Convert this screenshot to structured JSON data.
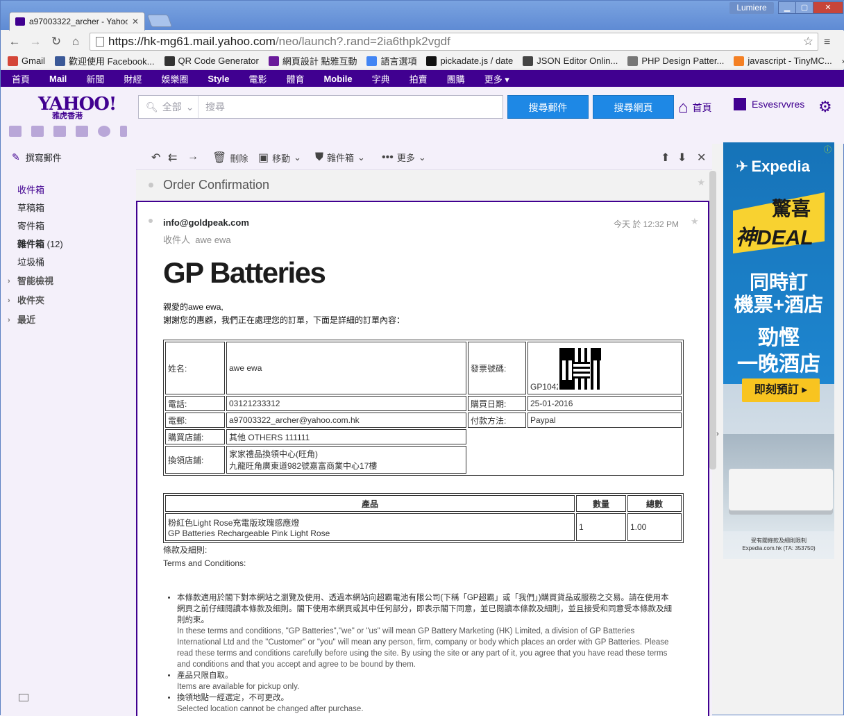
{
  "browser": {
    "tab_title": "a97003322_archer - Yahoo",
    "user_chip": "Lumiere",
    "url_host": "https://hk-mg61.mail.yahoo.com",
    "url_path": "/neo/launch?.rand=2ia6thpk2vgdf"
  },
  "bookmarks": [
    {
      "label": "Gmail",
      "icon": "gmail-icon",
      "color": "#d44638"
    },
    {
      "label": "歡迎使用 Facebook...",
      "icon": "facebook-icon",
      "color": "#3b5998"
    },
    {
      "label": "QR Code Generator",
      "icon": "qr-icon",
      "color": "#333333"
    },
    {
      "label": "網頁設計 點雅互動",
      "icon": "d-icon",
      "color": "#6a1b9a"
    },
    {
      "label": "語言選項",
      "icon": "translate-icon",
      "color": "#4285f4"
    },
    {
      "label": "pickadate.js / date",
      "icon": "p-icon",
      "color": "#111111"
    },
    {
      "label": "JSON Editor Onlin...",
      "icon": "json-icon",
      "color": "#444444"
    },
    {
      "label": "PHP Design Patter...",
      "icon": "php-icon",
      "color": "#777777"
    },
    {
      "label": "javascript - TinyMC...",
      "icon": "stack-icon",
      "color": "#f48024"
    }
  ],
  "bookmarks_more": "»",
  "ynav": [
    {
      "label": "首頁",
      "bold": false
    },
    {
      "label": "Mail",
      "bold": true
    },
    {
      "label": "新聞",
      "bold": false
    },
    {
      "label": "財經",
      "bold": false
    },
    {
      "label": "娛樂圈",
      "bold": false
    },
    {
      "label": "Style",
      "bold": true
    },
    {
      "label": "電影",
      "bold": false
    },
    {
      "label": "體育",
      "bold": false
    },
    {
      "label": "Mobile",
      "bold": true
    },
    {
      "label": "字典",
      "bold": false
    },
    {
      "label": "拍賣",
      "bold": false
    },
    {
      "label": "團購",
      "bold": false
    },
    {
      "label": "更多 ▾",
      "bold": false
    }
  ],
  "header": {
    "logo": "YAHOO!",
    "logo_sub": "雅虎香港",
    "scope": "全部",
    "search_placeholder": "搜尋",
    "search_mail": "搜尋郵件",
    "search_web": "搜尋網頁",
    "home": "首頁",
    "user": "Esvesrvvres"
  },
  "sidebar": {
    "compose": "撰寫郵件",
    "folders": [
      {
        "label": "收件箱",
        "active": true,
        "bold": false,
        "count": ""
      },
      {
        "label": "草稿箱",
        "active": false,
        "bold": false,
        "count": ""
      },
      {
        "label": "寄件箱",
        "active": false,
        "bold": false,
        "count": ""
      },
      {
        "label": "雜件箱",
        "active": false,
        "bold": true,
        "count": " (12)"
      },
      {
        "label": "垃圾桶",
        "active": false,
        "bold": false,
        "count": ""
      }
    ],
    "groups": [
      "智能檢視",
      "收件夾",
      "最近"
    ]
  },
  "toolbar": {
    "delete": "刪除",
    "move": "移動",
    "spam": "雜件箱",
    "more": "更多"
  },
  "email": {
    "subject": "Order Confirmation",
    "from": "info@goldpeak.com",
    "to_label": "收件人",
    "to": "awe ewa",
    "time": "今天 於 12:32 PM",
    "brand": "GP Batteries",
    "greeting": "親愛的awe ewa,",
    "intro": "謝謝您的惠顧，我們正在處理您的訂單，下面是詳細的訂單內容：",
    "order": {
      "name_label": "姓名:",
      "name": "awe ewa",
      "invoice_label": "發票號碼:",
      "invoice": "GP10429536",
      "phone_label": "電話:",
      "phone": "03121233312",
      "date_label": "購買日期:",
      "date": "25-01-2016",
      "email_label": "電郵:",
      "email": "a97003322_archer@yahoo.com.hk",
      "pay_label": "付款方法:",
      "pay": "Paypal",
      "store_label": "購買店鋪:",
      "store": "其他 OTHERS 111111",
      "pickup_label": "換領店鋪:",
      "pickup_line1": "家家禮品換領中心(旺角)",
      "pickup_line2": "九龍旺角廣東道982號嘉富商業中心17樓"
    },
    "products": {
      "headers": [
        "產品",
        "數量",
        "總數"
      ],
      "rows": [
        {
          "name_zh": "粉紅色Light Rose充電版玫瑰感應燈",
          "name_en": "GP Batteries Rechargeable Pink Light Rose",
          "qty": "1",
          "total": "1.00"
        }
      ]
    },
    "terms_zh": "條款及細則:",
    "terms_en": "Terms and Conditions:",
    "terms_items": [
      {
        "zh": "本條款適用於閣下對本網站之瀏覽及使用、透過本網站向超霸電池有限公司(下稱「GP超霸」或「我們」)購買貨品或服務之交易。請在使用本網頁之前仔細閱讀本條款及細則。閣下使用本網頁或其中任何部分，即表示閣下同意，並已閱讀本條款及細則，並且接受和同意受本條款及細則約束。",
        "en": "In these terms and conditions, \"GP Batteries\",\"we\" or \"us\" will mean GP Battery Marketing (HK) Limited, a division of GP Batteries International Ltd and the \"Customer\" or \"you\" will mean any person, firm, company or body which places an order with GP Batteries. Please read these terms and conditions carefully before using the site. By using the site or any part of it, you agree that you have read these terms and conditions and that you accept and agree to be bound by them."
      },
      {
        "zh": "產品只限自取。",
        "en": "Items are available for pickup only."
      },
      {
        "zh": "換領地點一經選定，不可更改。",
        "en": "Selected location cannot be changed after purchase."
      }
    ]
  },
  "ad": {
    "brand": "Expedia",
    "deal_a": "驚喜",
    "deal_b": "神DEAL",
    "line1": "同時訂",
    "line2": "機票+酒店",
    "line3": "勁慳",
    "line4": "一晚酒店",
    "cta": "即刻預訂 ▸",
    "foot1": "受有關條款及細則限制",
    "foot2": "Expedia.com.hk (TA: 353750)"
  }
}
